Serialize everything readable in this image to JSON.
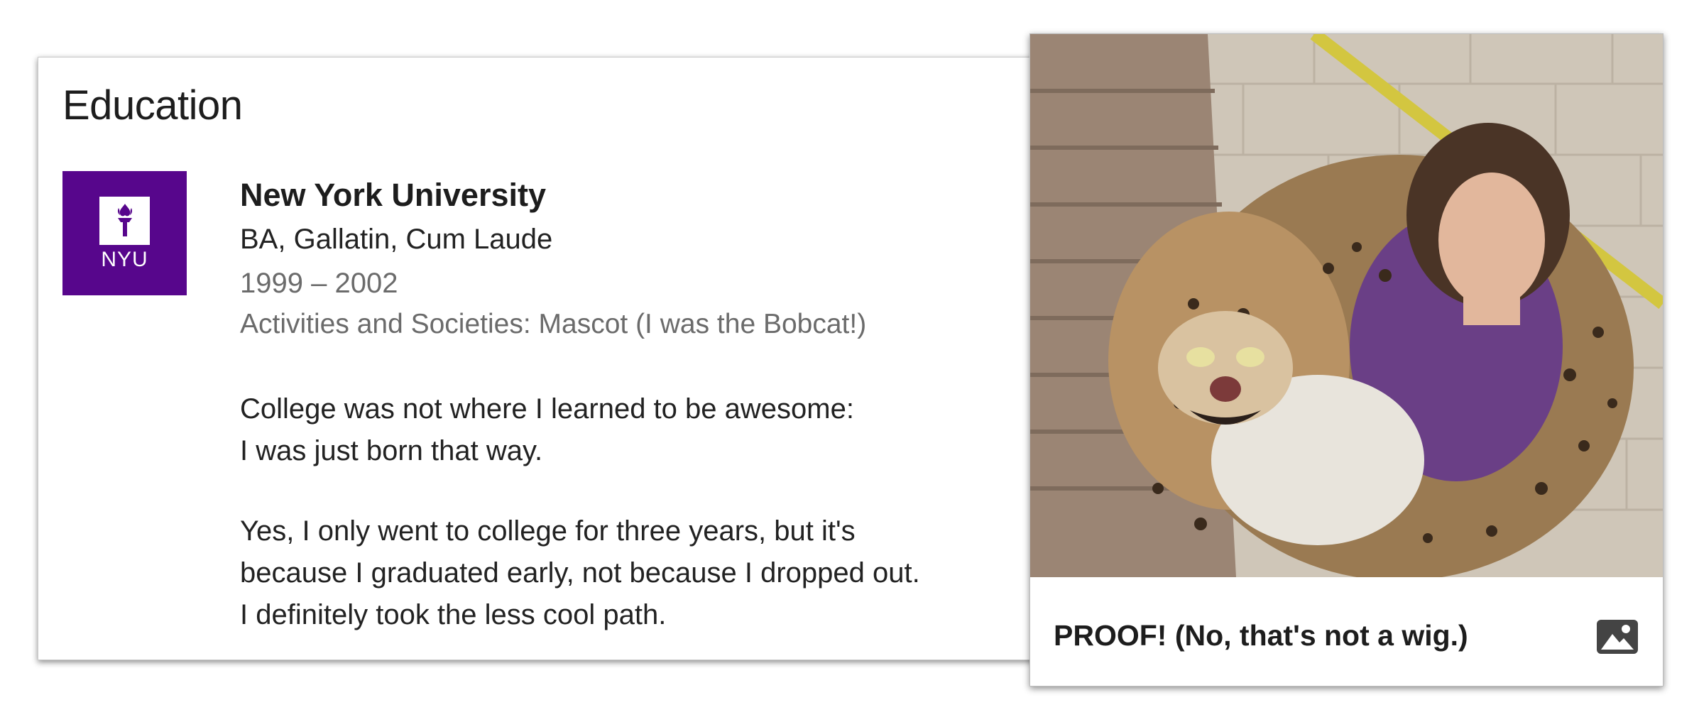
{
  "education": {
    "section_title": "Education",
    "entry": {
      "logo_text": "NYU",
      "school": "New York University",
      "degree": "BA, Gallatin, Cum Laude",
      "dates": "1999 – 2002",
      "activities": "Activities and Societies: Mascot (I was the Bobcat!)",
      "description": [
        [
          "College was not where I learned to be awesome:",
          "I was just born that way."
        ],
        [
          "Yes, I only went to college for three years, but it's",
          "because I graduated early, not because I dropped out.",
          "I definitely took the less cool path."
        ]
      ]
    }
  },
  "photo_card": {
    "caption": "PROOF! (No, that's not a wig.)",
    "icon": "image-icon"
  },
  "colors": {
    "nyu_purple": "#57068c",
    "text_primary": "#1d1d1d",
    "text_secondary": "#6b6b6b"
  }
}
